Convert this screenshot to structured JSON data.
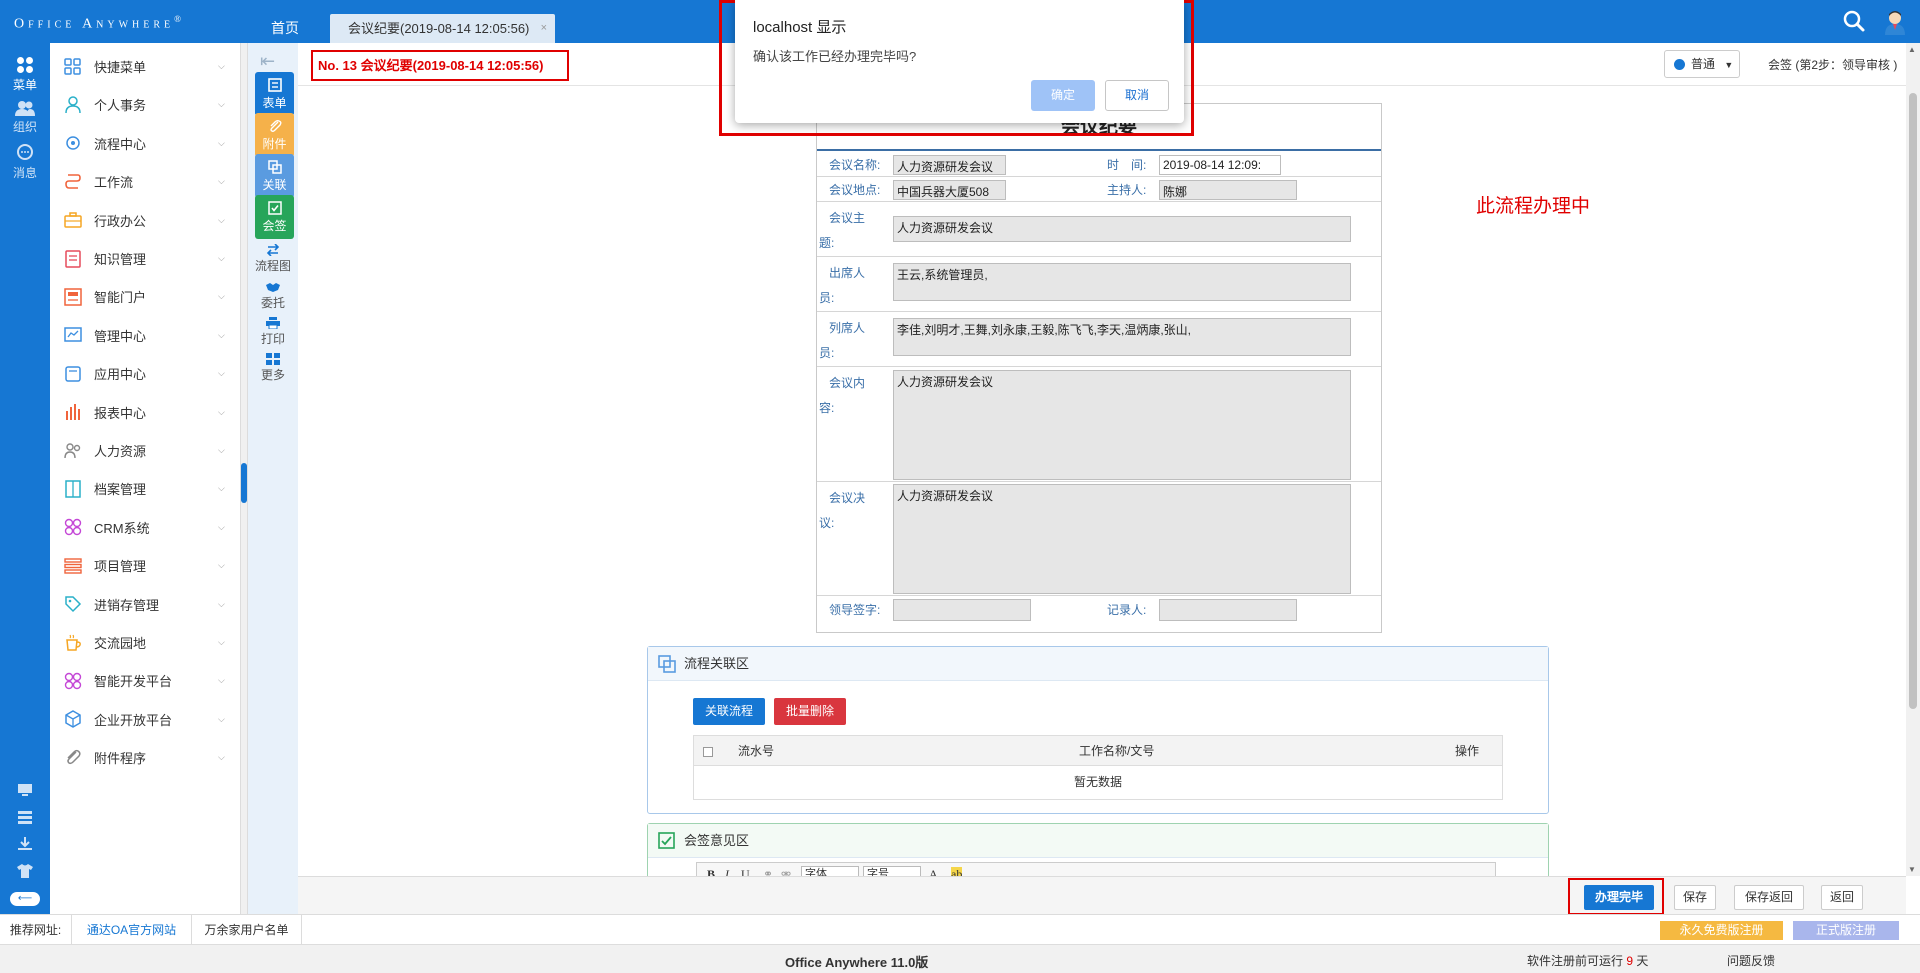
{
  "topbar": {
    "logo": "Office Anywhere",
    "logo_mark": "®",
    "home_tab": "首页",
    "active_tab": "会议纪要(2019-08-14 12:05:56)",
    "close_glyph": "×"
  },
  "left_strip": {
    "items": [
      {
        "label": "菜单",
        "icon": "apps-icon",
        "active": true
      },
      {
        "label": "组织",
        "icon": "people-icon",
        "active": false
      },
      {
        "label": "消息",
        "icon": "chat-icon",
        "active": false
      }
    ],
    "bottom_icons": [
      "monitor-icon",
      "layers-icon",
      "download-icon",
      "shirt-icon"
    ],
    "collapse_pill": "⟵"
  },
  "menu": {
    "items": [
      {
        "label": "快捷菜单",
        "icon": "grid-icon",
        "color": "#3d8fe0"
      },
      {
        "label": "个人事务",
        "icon": "user-icon",
        "color": "#2ab0c9"
      },
      {
        "label": "流程中心",
        "icon": "gear-icon",
        "color": "#3d8fe0"
      },
      {
        "label": "工作流",
        "icon": "flow-icon",
        "color": "#f0643c"
      },
      {
        "label": "行政办公",
        "icon": "briefcase-icon",
        "color": "#f5a623"
      },
      {
        "label": "知识管理",
        "icon": "book-icon",
        "color": "#e64b5c"
      },
      {
        "label": "智能门户",
        "icon": "portal-icon",
        "color": "#f0643c"
      },
      {
        "label": "管理中心",
        "icon": "chart-icon",
        "color": "#3d8fe0"
      },
      {
        "label": "应用中心",
        "icon": "app-icon",
        "color": "#3d8fe0"
      },
      {
        "label": "报表中心",
        "icon": "bar-chart-icon",
        "color": "#f0643c"
      },
      {
        "label": "人力资源",
        "icon": "people-icon",
        "color": "#888888"
      },
      {
        "label": "档案管理",
        "icon": "archive-icon",
        "color": "#2ab0c9"
      },
      {
        "label": "CRM系统",
        "icon": "flower-icon",
        "color": "#c447d6"
      },
      {
        "label": "项目管理",
        "icon": "list-icon",
        "color": "#f0643c"
      },
      {
        "label": "进销存管理",
        "icon": "tag-icon",
        "color": "#2ab0c9"
      },
      {
        "label": "交流园地",
        "icon": "cup-icon",
        "color": "#f5a623"
      },
      {
        "label": "智能开发平台",
        "icon": "flower-icon",
        "color": "#c447d6"
      },
      {
        "label": "企业开放平台",
        "icon": "cube-icon",
        "color": "#3d8fe0"
      },
      {
        "label": "附件程序",
        "icon": "clip-icon",
        "color": "#888888"
      }
    ]
  },
  "tools": {
    "collapse_icon": "⇤",
    "buttons": [
      {
        "label": "表单",
        "icon": "form-icon",
        "color": "#1677d3"
      },
      {
        "label": "附件",
        "icon": "paperclip-icon",
        "color": "#f5b14a"
      },
      {
        "label": "关联",
        "icon": "link-icon",
        "color": "#5a9be0"
      },
      {
        "label": "会签",
        "icon": "check-icon",
        "color": "#27a55a"
      }
    ],
    "lite": [
      {
        "label": "流程图",
        "icon": "flowchart-icon"
      },
      {
        "label": "委托",
        "icon": "handshake-icon"
      },
      {
        "label": "打印",
        "icon": "printer-icon"
      },
      {
        "label": "更多",
        "icon": "more-icon"
      }
    ]
  },
  "header": {
    "doc_title": "No. 13 会议纪要(2019-08-14 12:05:56)",
    "mode": "普通",
    "step": "会签 (第2步：领导审核 )",
    "processing": "此流程办理中"
  },
  "form": {
    "title": "会议纪要",
    "name_label": "会议名称:",
    "name_value": "人力资源研发会议",
    "time_label": "时　间:",
    "time_value": "2019-08-14 12:09:",
    "place_label": "会议地点:",
    "place_value": "中国兵器大厦508",
    "host_label": "主持人:",
    "host_value": "陈娜",
    "topic_label_1": "会议主",
    "topic_label_2": "题:",
    "topic_value": "人力资源研发会议",
    "attend_label_1": "出席人",
    "attend_label_2": "员:",
    "attend_value": "王云,系统管理员,",
    "present_label_1": "列席人",
    "present_label_2": "员:",
    "present_value": "李佳,刘明才,王舞,刘永康,王毅,陈飞飞,李天,温炳康,张山,",
    "content_label_1": "会议内",
    "content_label_2": "容:",
    "content_value": "人力资源研发会议",
    "decision_label_1": "会议决",
    "decision_label_2": "议:",
    "decision_value": "人力资源研发会议",
    "leader_sign_label": "领导签字:",
    "leader_sign_value": "",
    "recorder_label": "记录人:",
    "recorder_value": ""
  },
  "relation_panel": {
    "title": "流程关联区",
    "btn_link": "关联流程",
    "btn_delete": "批量删除",
    "columns": [
      "流水号",
      "工作名称/文号",
      "操作"
    ],
    "empty": "暂无数据"
  },
  "sign_panel": {
    "title": "会签意见区",
    "toolbar": [
      "B",
      "I",
      "U"
    ],
    "font_select": "字体",
    "size_select": "字号",
    "font_color": "A",
    "highlight": "ab"
  },
  "actions": {
    "complete": "办理完毕",
    "save": "保存",
    "save_return": "保存返回",
    "return": "返回"
  },
  "linkbar": {
    "label": "推荐网址:",
    "links": [
      "通达OA官方网站",
      "万余家用户名单"
    ],
    "free_register": "永久免费版注册",
    "official_register": "正式版注册"
  },
  "status": {
    "version": "Office Anywhere 11.0版",
    "trial_prefix": "软件注册前可运行",
    "trial_days": "9",
    "trial_suffix": "天",
    "feedback": "问题反馈"
  },
  "dialog": {
    "title": "localhost 显示",
    "message": "确认该工作已经办理完毕吗?",
    "ok": "确定",
    "cancel": "取消"
  }
}
